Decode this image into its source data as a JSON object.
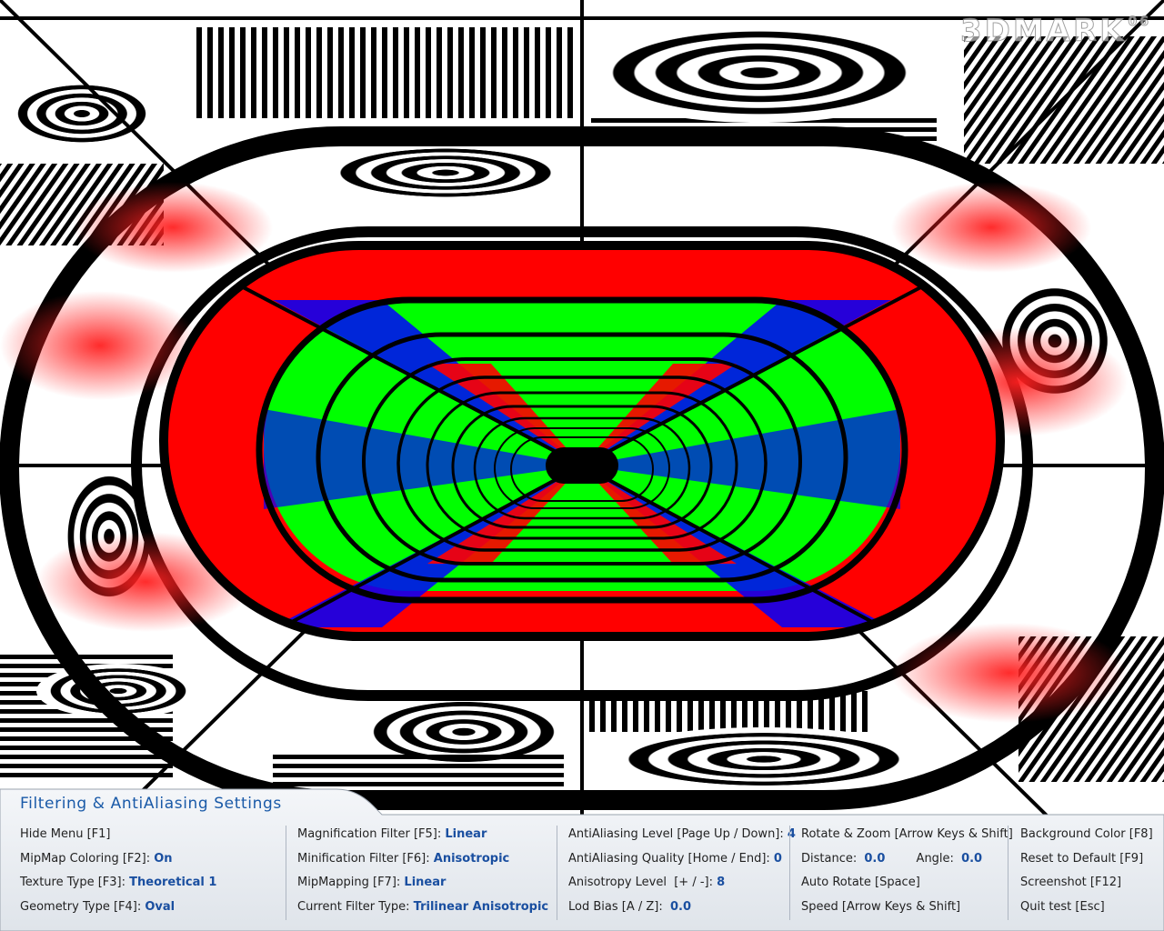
{
  "logo": {
    "text": "3DMARK",
    "suffix": "06"
  },
  "panel": {
    "title": "Filtering & AntiAliasing Settings",
    "col1": [
      {
        "label": "Hide Menu [F1]",
        "value": ""
      },
      {
        "label": "MipMap Coloring [F2]:",
        "value": "On"
      },
      {
        "label": "Texture Type [F3]:",
        "value": "Theoretical 1"
      },
      {
        "label": "Geometry Type [F4]:",
        "value": "Oval"
      }
    ],
    "col2": [
      {
        "label": "Magnification Filter [F5]:",
        "value": "Linear"
      },
      {
        "label": "Minification Filter [F6]:",
        "value": "Anisotropic"
      },
      {
        "label": "MipMapping [F7]:",
        "value": "Linear"
      },
      {
        "label": "Current Filter Type:",
        "value": "Trilinear Anisotropic"
      }
    ],
    "col3": [
      {
        "label": "AntiAliasing Level [Page Up / Down]:",
        "value": "4"
      },
      {
        "label": "AntiAliasing Quality [Home / End]:",
        "value": "0"
      },
      {
        "label": "Anisotropy Level  [+ / -]:",
        "value": "8"
      },
      {
        "label": "Lod Bias [A / Z]:",
        "value": "0.0"
      }
    ],
    "col4": {
      "rotate_zoom": "Rotate & Zoom [Arrow Keys & Shift]",
      "distance_label": "Distance:",
      "distance_value": "0.0",
      "angle_label": "Angle:",
      "angle_value": "0.0",
      "auto_rotate": "Auto Rotate [Space]",
      "speed": "Speed [Arrow Keys & Shift]"
    },
    "col5": [
      {
        "label": "Background Color [F8]"
      },
      {
        "label": "Reset to Default [F9]"
      },
      {
        "label": "Screenshot [F12]"
      },
      {
        "label": "Quit test [Esc]"
      }
    ]
  },
  "colors": {
    "mip_red": "#ff0000",
    "mip_green": "#00ff00",
    "mip_blue": "#0000ff",
    "accent": "#1a4fa0"
  }
}
